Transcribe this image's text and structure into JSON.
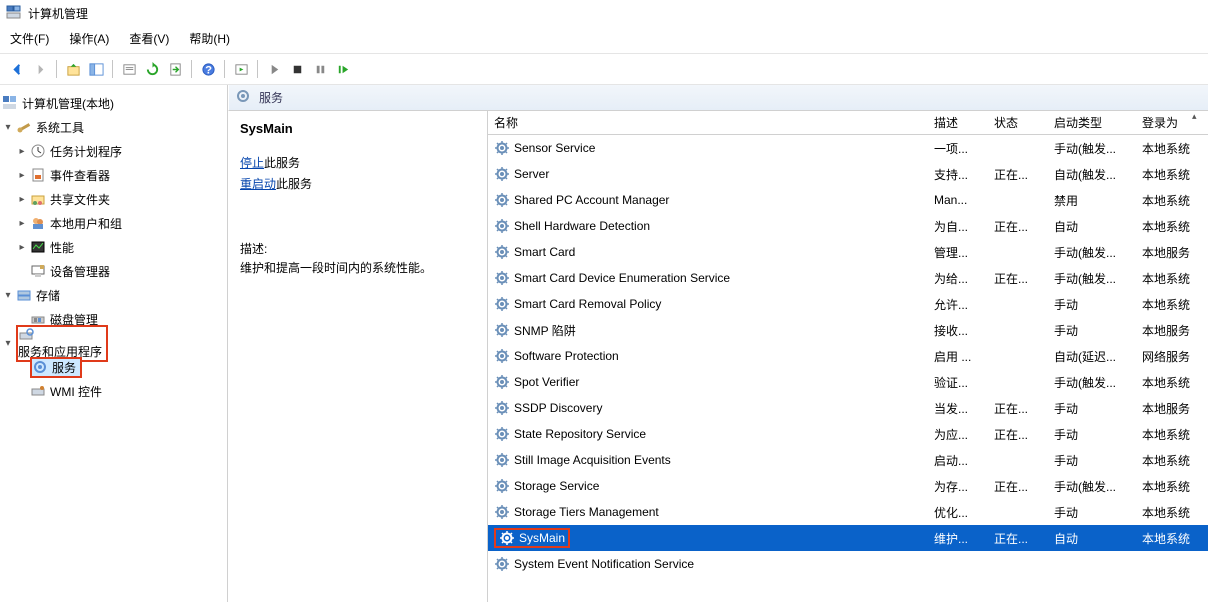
{
  "window": {
    "title": "计算机管理"
  },
  "menu": {
    "file": "文件(F)",
    "action": "操作(A)",
    "view": "查看(V)",
    "help": "帮助(H)"
  },
  "tree": {
    "root": "计算机管理(本地)",
    "systools": "系统工具",
    "task": "任务计划程序",
    "event": "事件查看器",
    "shared": "共享文件夹",
    "users": "本地用户和组",
    "perf": "性能",
    "devmgr": "设备管理器",
    "storage": "存储",
    "diskmgr": "磁盘管理",
    "svcapps": "服务和应用程序",
    "services": "服务",
    "wmi": "WMI 控件"
  },
  "rp": {
    "header": "服务"
  },
  "detail": {
    "title": "SysMain",
    "stop1": "停止",
    "stop2": "此服务",
    "restart1": "重启动",
    "restart2": "此服务",
    "descLabel": "描述:",
    "descText": "维护和提高一段时间内的系统性能。"
  },
  "cols": {
    "name": "名称",
    "desc": "描述",
    "status": "状态",
    "start": "启动类型",
    "logon": "登录为"
  },
  "services": [
    {
      "name": "Sensor Service",
      "desc": "一项...",
      "status": "",
      "start": "手动(触发...",
      "logon": "本地系统"
    },
    {
      "name": "Server",
      "desc": "支持...",
      "status": "正在...",
      "start": "自动(触发...",
      "logon": "本地系统"
    },
    {
      "name": "Shared PC Account Manager",
      "desc": "Man...",
      "status": "",
      "start": "禁用",
      "logon": "本地系统"
    },
    {
      "name": "Shell Hardware Detection",
      "desc": "为自...",
      "status": "正在...",
      "start": "自动",
      "logon": "本地系统"
    },
    {
      "name": "Smart Card",
      "desc": "管理...",
      "status": "",
      "start": "手动(触发...",
      "logon": "本地服务"
    },
    {
      "name": "Smart Card Device Enumeration Service",
      "desc": "为给...",
      "status": "正在...",
      "start": "手动(触发...",
      "logon": "本地系统"
    },
    {
      "name": "Smart Card Removal Policy",
      "desc": "允许...",
      "status": "",
      "start": "手动",
      "logon": "本地系统"
    },
    {
      "name": "SNMP 陷阱",
      "desc": "接收...",
      "status": "",
      "start": "手动",
      "logon": "本地服务"
    },
    {
      "name": "Software Protection",
      "desc": "启用 ...",
      "status": "",
      "start": "自动(延迟...",
      "logon": "网络服务"
    },
    {
      "name": "Spot Verifier",
      "desc": "验证...",
      "status": "",
      "start": "手动(触发...",
      "logon": "本地系统"
    },
    {
      "name": "SSDP Discovery",
      "desc": "当发...",
      "status": "正在...",
      "start": "手动",
      "logon": "本地服务"
    },
    {
      "name": "State Repository Service",
      "desc": "为应...",
      "status": "正在...",
      "start": "手动",
      "logon": "本地系统"
    },
    {
      "name": "Still Image Acquisition Events",
      "desc": "启动...",
      "status": "",
      "start": "手动",
      "logon": "本地系统"
    },
    {
      "name": "Storage Service",
      "desc": "为存...",
      "status": "正在...",
      "start": "手动(触发...",
      "logon": "本地系统"
    },
    {
      "name": "Storage Tiers Management",
      "desc": "优化...",
      "status": "",
      "start": "手动",
      "logon": "本地系统"
    },
    {
      "name": "SysMain",
      "desc": "维护...",
      "status": "正在...",
      "start": "自动",
      "logon": "本地系统",
      "selected": true,
      "highlight": true
    },
    {
      "name": "System Event Notification Service",
      "desc": "",
      "status": "",
      "start": "",
      "logon": ""
    }
  ]
}
